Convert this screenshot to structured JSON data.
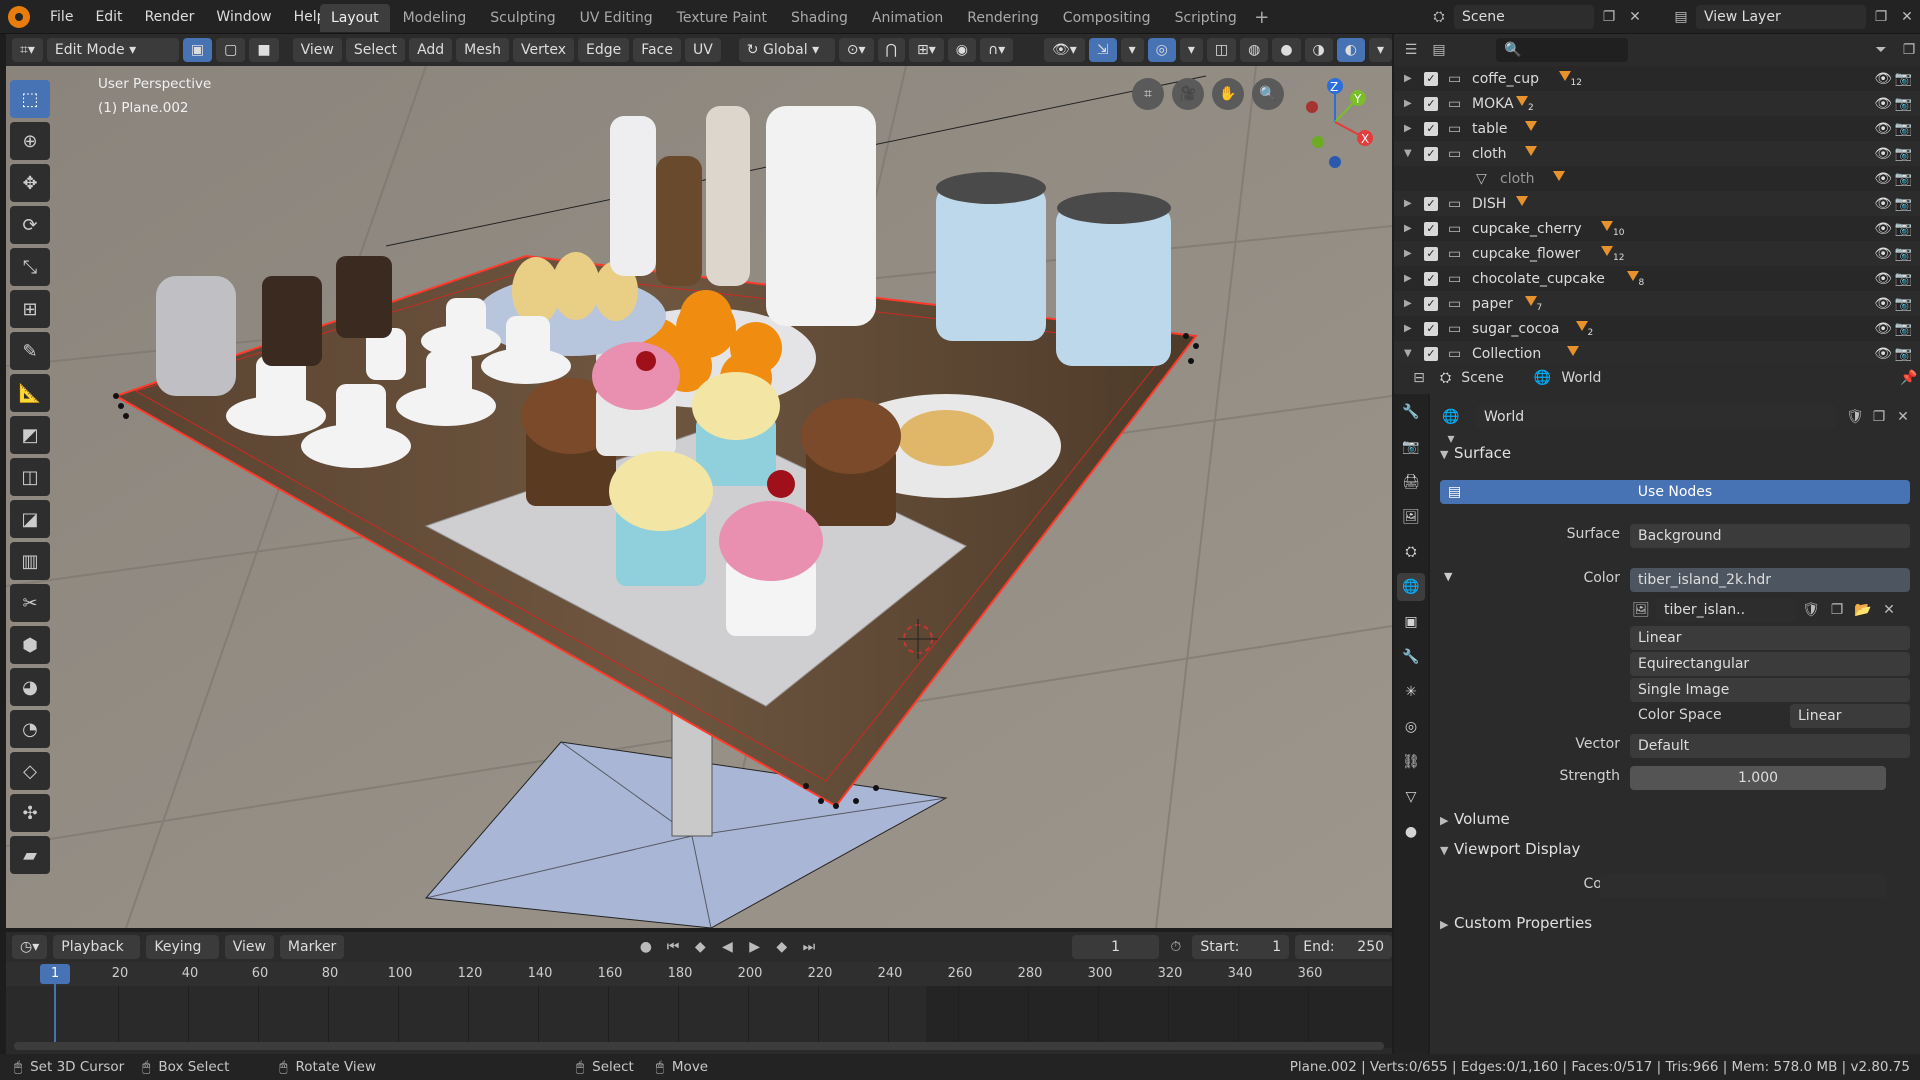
{
  "menu": [
    "File",
    "Edit",
    "Render",
    "Window",
    "Help"
  ],
  "workspaces": [
    {
      "label": "Layout",
      "active": true
    },
    {
      "label": "Modeling"
    },
    {
      "label": "Sculpting"
    },
    {
      "label": "UV Editing"
    },
    {
      "label": "Texture Paint"
    },
    {
      "label": "Shading"
    },
    {
      "label": "Animation"
    },
    {
      "label": "Rendering"
    },
    {
      "label": "Compositing"
    },
    {
      "label": "Scripting"
    }
  ],
  "add_tab": "+",
  "scene": {
    "label": "Scene",
    "view_layer": "View Layer"
  },
  "viewport_header": {
    "mode": "Edit Mode",
    "view": "View",
    "select": "Select",
    "add": "Add",
    "mesh": "Mesh",
    "vertex": "Vertex",
    "edge": "Edge",
    "face": "Face",
    "uv": "UV",
    "orientation": "Global"
  },
  "viewport": {
    "overlay_title": "User Perspective",
    "overlay_object": "(1) Plane.002"
  },
  "gizmo": {
    "x": "X",
    "y": "Y",
    "z": "Z"
  },
  "tools": [
    "select-box",
    "cursor",
    "move",
    "rotate",
    "scale",
    "transform",
    "annotate",
    "measure",
    "extrude",
    "inset",
    "bevel",
    "loop-cut",
    "knife",
    "poly-build",
    "spin",
    "smooth",
    "edge-slide",
    "shrink-fatten",
    "shear"
  ],
  "timeline_header": {
    "playback": "Playback",
    "keying": "Keying",
    "view": "View",
    "marker": "Marker",
    "current_frame": "1",
    "start_label": "Start:",
    "start": "1",
    "end_label": "End:",
    "end": "250"
  },
  "timeline": {
    "current": "1",
    "ticks": [
      "20",
      "40",
      "60",
      "80",
      "100",
      "120",
      "140",
      "160",
      "180",
      "200",
      "220",
      "240",
      "260",
      "280",
      "300",
      "320",
      "340",
      "360"
    ]
  },
  "statusbar": {
    "set_cursor": "Set 3D Cursor",
    "box_select": "Box Select",
    "rotate_view": "Rotate View",
    "select": "Select",
    "move": "Move",
    "stats": "Plane.002 | Verts:0/655 | Edges:0/1,160 | Faces:0/517 | Tris:966 | Mem: 578.0 MB | v2.80.75"
  },
  "outliner": {
    "rows": [
      {
        "name": "coffe_cup",
        "badge": "12",
        "expanded": false
      },
      {
        "name": "MOKA",
        "badge": "2",
        "expanded": false
      },
      {
        "name": "table",
        "badge": "",
        "expanded": false
      },
      {
        "name": "cloth",
        "badge": "",
        "expanded": true
      },
      {
        "name": "cloth",
        "badge": "",
        "child": true
      },
      {
        "name": "DISH",
        "badge": "",
        "expanded": false
      },
      {
        "name": "cupcake_cherry",
        "badge": "10",
        "expanded": false
      },
      {
        "name": "cupcake_flower",
        "badge": "12",
        "expanded": false
      },
      {
        "name": "chocolate_cupcake",
        "badge": "8",
        "expanded": false
      },
      {
        "name": "paper",
        "badge": "7",
        "expanded": false
      },
      {
        "name": "sugar_cocoa",
        "badge": "2",
        "expanded": false
      },
      {
        "name": "Collection",
        "badge": "",
        "expanded": true
      }
    ]
  },
  "properties": {
    "breadcrumb_scene": "Scene",
    "breadcrumb_world": "World",
    "world_name": "World",
    "surface_panel": "Surface",
    "use_nodes": "Use Nodes",
    "surface_label": "Surface",
    "surface_value": "Background",
    "color_label": "Color",
    "color_value": "tiber_island_2k.hdr",
    "image_name": "tiber_islan..",
    "interpolation": "Linear",
    "projection": "Equirectangular",
    "source": "Single Image",
    "color_space_label": "Color Space",
    "color_space": "Linear",
    "vector_label": "Vector",
    "vector_value": "Default",
    "strength_label": "Strength",
    "strength_value": "1.000",
    "volume_panel": "Volume",
    "viewport_display_panel": "Viewport Display",
    "vd_color_label": "Color",
    "custom_props_panel": "Custom Properties"
  },
  "colors": {
    "accent": "#4772b3",
    "orange": "#e8922e",
    "bg": "#2b2b2b"
  }
}
